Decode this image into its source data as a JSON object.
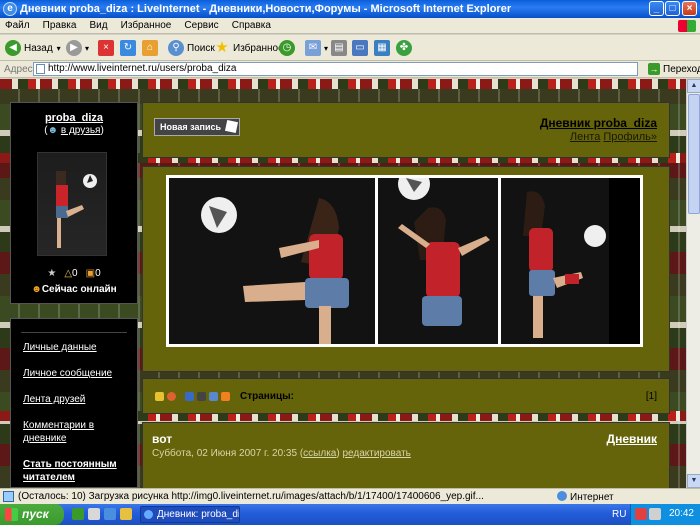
{
  "window": {
    "title": "Дневник proba_diza : LiveInternet - Дневники,Новости,Форумы - Microsoft Internet Explorer"
  },
  "menu": [
    "Файл",
    "Правка",
    "Вид",
    "Избранное",
    "Сервис",
    "Справка"
  ],
  "toolbar": {
    "back_label": "Назад",
    "search_label": "Поиск",
    "favorites_label": "Избранное"
  },
  "address": {
    "label": "Адрес:",
    "url": "http://www.liveinternet.ru/users/proba_diza",
    "go_label": "Переход"
  },
  "profile": {
    "username": "proba_diza",
    "friends_link": "в друзья",
    "stat_a": "0",
    "stat_b": "0",
    "online_label": "Сейчас онлайн"
  },
  "nav": [
    "Личные данные",
    "Личное сообщение",
    "Лента друзей",
    "Комментарии в дневнике",
    "Стать постоянным читателем"
  ],
  "header": {
    "new_post": "Новая запись",
    "blog_title": "Дневник proba_diza",
    "link_feed": "Лента",
    "link_profile": "Профиль»"
  },
  "pager": {
    "label": "Страницы:",
    "current": "[1]"
  },
  "post": {
    "title": "вот",
    "category": "Дневник",
    "date": "Суббота, 02 Июня 2007 г. 20:35",
    "link_label": "ссылка",
    "edit_label": "редактировать"
  },
  "status": {
    "text": "(Осталось: 10) Загрузка рисунка http://img0.liveinternet.ru/images/attach/b/1/17400/17400606_yep.gif...",
    "zone": "Интернет"
  },
  "taskbar": {
    "start_label": "пуск",
    "task_label": "Дневник: proba_diza ...",
    "lang": "RU",
    "time": "20:42"
  },
  "colors": {
    "panel_olive": "#66640a",
    "sidebar_black": "#000000",
    "xp_blue": "#245edb"
  }
}
